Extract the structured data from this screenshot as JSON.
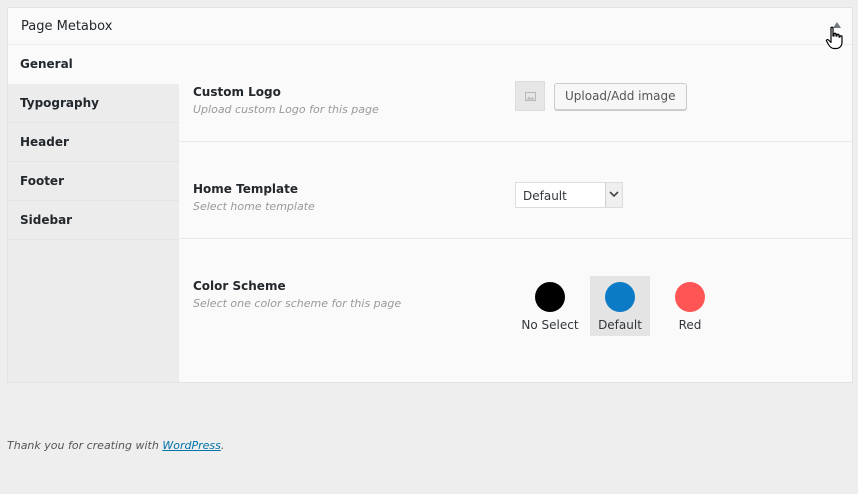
{
  "metabox": {
    "title": "Page Metabox"
  },
  "tabs": [
    {
      "label": "General"
    },
    {
      "label": "Typography"
    },
    {
      "label": "Header"
    },
    {
      "label": "Footer"
    },
    {
      "label": "Sidebar"
    }
  ],
  "fields": {
    "custom_logo": {
      "label": "Custom Logo",
      "description": "Upload custom Logo for this page",
      "button_label": "Upload/Add image"
    },
    "home_template": {
      "label": "Home Template",
      "description": "Select home template",
      "selected_value": "Default"
    },
    "color_scheme": {
      "label": "Color Scheme",
      "description": "Select one color scheme for this page",
      "options": [
        {
          "label": "No Select",
          "color": "#000000"
        },
        {
          "label": "Default",
          "color": "#0a7bc4"
        },
        {
          "label": "Red",
          "color": "#ff5555"
        }
      ]
    }
  },
  "footer": {
    "prefix": "Thank you for creating with ",
    "link_label": "WordPress",
    "suffix": "."
  },
  "colors": {
    "accent": "#0073aa",
    "selected_swatch_bg": "#e4e4e4"
  }
}
